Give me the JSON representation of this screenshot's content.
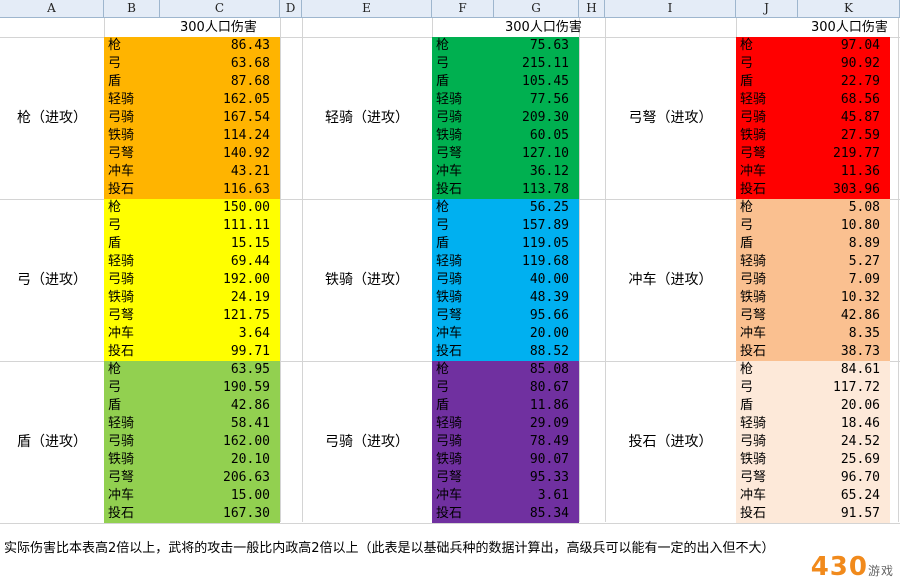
{
  "columns": [
    "A",
    "B",
    "C",
    "D",
    "E",
    "F",
    "G",
    "H",
    "I",
    "J",
    "K"
  ],
  "header_label": "300人口伤害",
  "units": [
    "枪",
    "弓",
    "盾",
    "轻骑",
    "弓骑",
    "铁骑",
    "弓弩",
    "冲车",
    "投石"
  ],
  "attackers": [
    {
      "label": "枪（进攻）",
      "color": "#ffb400",
      "values": [
        "86.43",
        "63.68",
        "87.68",
        "162.05",
        "167.54",
        "114.24",
        "140.92",
        "43.21",
        "116.63"
      ]
    },
    {
      "label": "弓（进攻）",
      "color": "#ffff00",
      "values": [
        "150.00",
        "111.11",
        "15.15",
        "69.44",
        "192.00",
        "24.19",
        "121.75",
        "3.64",
        "99.71"
      ]
    },
    {
      "label": "盾（进攻）",
      "color": "#92d050",
      "values": [
        "63.95",
        "190.59",
        "42.86",
        "58.41",
        "162.00",
        "20.10",
        "206.63",
        "15.00",
        "167.30"
      ]
    },
    {
      "label": "轻骑（进攻）",
      "color": "#00b050",
      "values": [
        "75.63",
        "215.11",
        "105.45",
        "77.56",
        "209.30",
        "60.05",
        "127.10",
        "36.12",
        "113.78"
      ]
    },
    {
      "label": "铁骑（进攻）",
      "color": "#00b0f0",
      "values": [
        "56.25",
        "157.89",
        "119.05",
        "119.68",
        "40.00",
        "48.39",
        "95.66",
        "20.00",
        "88.52"
      ]
    },
    {
      "label": "弓骑（进攻）",
      "color": "#7030a0",
      "values": [
        "85.08",
        "80.67",
        "11.86",
        "29.09",
        "78.49",
        "90.07",
        "95.33",
        "3.61",
        "85.34"
      ]
    },
    {
      "label": "弓弩（进攻）",
      "color": "#ff0000",
      "values": [
        "97.04",
        "90.92",
        "22.79",
        "68.56",
        "45.87",
        "27.59",
        "219.77",
        "11.36",
        "303.96"
      ]
    },
    {
      "label": "冲车（进攻）",
      "color": "#fac090",
      "values": [
        "5.08",
        "10.80",
        "8.89",
        "5.27",
        "7.09",
        "10.32",
        "42.86",
        "8.35",
        "38.73"
      ]
    },
    {
      "label": "投石（进攻）",
      "color": "#fde9d9",
      "values": [
        "84.61",
        "117.72",
        "20.06",
        "18.46",
        "24.52",
        "25.69",
        "96.70",
        "65.24",
        "91.57"
      ]
    }
  ],
  "footer": "实际伤害比本表高2倍以上，武将的攻击一般比内政高2倍以上（此表是以基础兵种的数据计算出，高级兵可以能有一定的出入但不大）",
  "watermark": "430",
  "watermark_sub": "游戏"
}
